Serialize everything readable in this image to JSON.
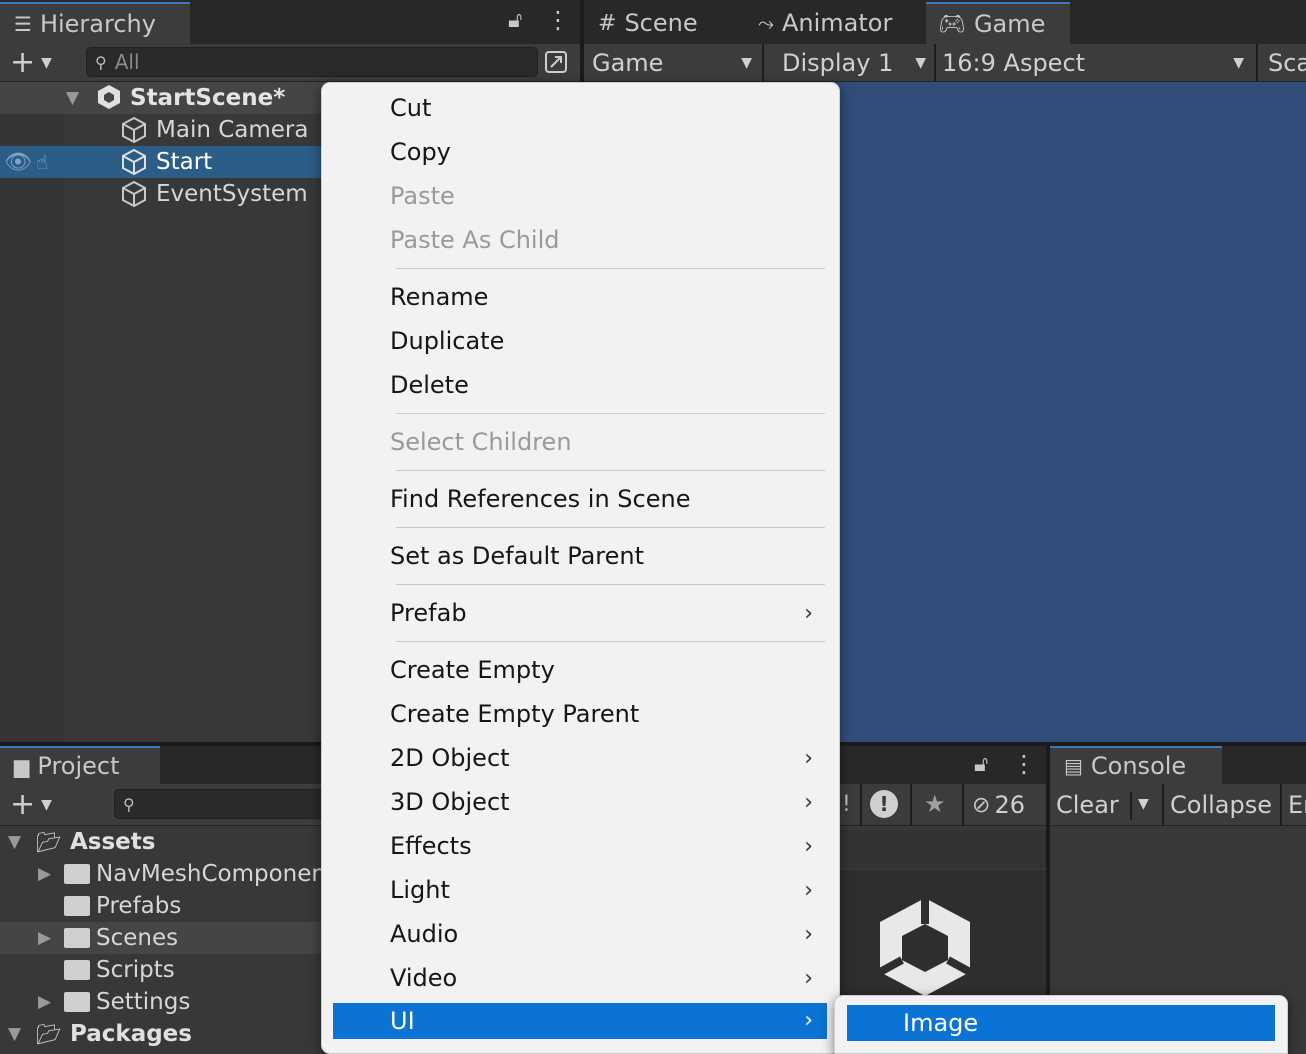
{
  "hierarchy": {
    "tab_label": "Hierarchy",
    "search_placeholder": "All",
    "scene_name": "StartScene*",
    "items": [
      "Main Camera",
      "Start",
      "EventSystem"
    ]
  },
  "view_tabs": [
    {
      "label": "Scene",
      "icon": "grid-icon"
    },
    {
      "label": "Animator",
      "icon": "animator-icon"
    },
    {
      "label": "Game",
      "icon": "gamepad-icon"
    }
  ],
  "game_toolbar": {
    "mode": "Game",
    "display": "Display 1",
    "aspect": "16:9 Aspect",
    "scale_partial": "Sca"
  },
  "project": {
    "tab_label": "Project",
    "tree": [
      {
        "label": "Assets",
        "level": 0,
        "expanded": true,
        "has_arrow": true
      },
      {
        "label": "NavMeshComponents",
        "level": 1,
        "has_arrow": true
      },
      {
        "label": "Prefabs",
        "level": 1,
        "has_arrow": false
      },
      {
        "label": "Scenes",
        "level": 1,
        "has_arrow": true,
        "selected": true
      },
      {
        "label": "Scripts",
        "level": 1,
        "has_arrow": false
      },
      {
        "label": "Settings",
        "level": 1,
        "has_arrow": true
      },
      {
        "label": "Packages",
        "level": 0,
        "expanded": true,
        "has_arrow": true
      }
    ],
    "hidden_count": "26"
  },
  "console": {
    "tab_label": "Console",
    "clear_label": "Clear",
    "collapse_label": "Collapse",
    "partial_label": "Er"
  },
  "context_menu": {
    "items": [
      {
        "label": "Cut",
        "enabled": true
      },
      {
        "label": "Copy",
        "enabled": true
      },
      {
        "label": "Paste",
        "enabled": false
      },
      {
        "label": "Paste As Child",
        "enabled": false
      },
      {
        "label": "Rename",
        "enabled": true
      },
      {
        "label": "Duplicate",
        "enabled": true
      },
      {
        "label": "Delete",
        "enabled": true
      },
      {
        "label": "Select Children",
        "enabled": false
      },
      {
        "label": "Find References in Scene",
        "enabled": true
      },
      {
        "label": "Set as Default Parent",
        "enabled": true
      },
      {
        "label": "Prefab",
        "enabled": true,
        "submenu": true
      },
      {
        "label": "Create Empty",
        "enabled": true
      },
      {
        "label": "Create Empty Parent",
        "enabled": true
      },
      {
        "label": "2D Object",
        "enabled": true,
        "submenu": true
      },
      {
        "label": "3D Object",
        "enabled": true,
        "submenu": true
      },
      {
        "label": "Effects",
        "enabled": true,
        "submenu": true
      },
      {
        "label": "Light",
        "enabled": true,
        "submenu": true
      },
      {
        "label": "Audio",
        "enabled": true,
        "submenu": true
      },
      {
        "label": "Video",
        "enabled": true,
        "submenu": true
      },
      {
        "label": "UI",
        "enabled": true,
        "submenu": true,
        "highlighted": true
      }
    ],
    "submenu_arrow": "›"
  },
  "submenu": {
    "items": [
      {
        "label": "Image",
        "highlighted": true
      }
    ]
  },
  "colors": {
    "game_view_bg": "#314d79",
    "menu_highlight": "#0b73d3",
    "selection": "#2c5d87"
  }
}
